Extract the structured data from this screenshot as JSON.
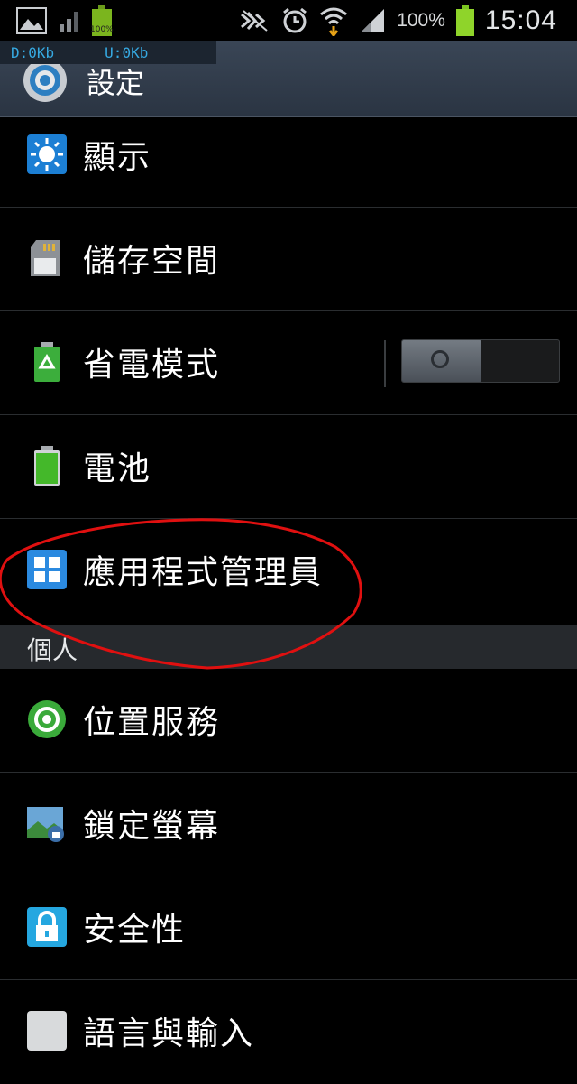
{
  "statusbar": {
    "battery_percent": "100%",
    "time": "15:04",
    "mini_battery_label": "100%"
  },
  "net_overlay": {
    "download": "D:0Kb",
    "upload": "U:0Kb"
  },
  "header": {
    "title": "設定"
  },
  "items": [
    {
      "label": "顯示",
      "icon": "display-brightness-icon"
    },
    {
      "label": "儲存空間",
      "icon": "sd-card-icon"
    },
    {
      "label": "省電模式",
      "icon": "power-saving-icon",
      "toggle": false
    },
    {
      "label": "電池",
      "icon": "battery-icon"
    },
    {
      "label": "應用程式管理員",
      "icon": "app-grid-icon"
    }
  ],
  "section": {
    "label": "個人"
  },
  "personal_items": [
    {
      "label": "位置服務",
      "icon": "location-icon"
    },
    {
      "label": "鎖定螢幕",
      "icon": "lock-screen-icon"
    },
    {
      "label": "安全性",
      "icon": "padlock-icon"
    },
    {
      "label": "語言與輸入",
      "icon": "language-icon"
    }
  ],
  "colors": {
    "accent": "#36a9e1",
    "annotation": "#e01010",
    "titlebar": "#323d4b"
  }
}
